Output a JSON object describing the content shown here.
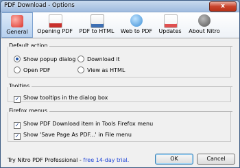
{
  "window": {
    "title": "PDF Download - Options",
    "close_label": "x"
  },
  "tabs": [
    {
      "label": "General",
      "icon": "general-icon",
      "color": "#d9342b"
    },
    {
      "label": "Opening PDF",
      "icon": "opening-pdf-icon",
      "color": "#c9302c"
    },
    {
      "label": "PDF to HTML",
      "icon": "pdf-to-html-icon",
      "color": "#3e6fb3"
    },
    {
      "label": "Web to PDF",
      "icon": "web-to-pdf-icon",
      "color": "#3d8fd6"
    },
    {
      "label": "Updates",
      "icon": "updates-icon",
      "color": "#e05050"
    },
    {
      "label": "About Nitro",
      "icon": "nitro-icon",
      "color": "#6a6a6a"
    }
  ],
  "default_action": {
    "legend": "Default action",
    "options": [
      {
        "label": "Show popup dialog",
        "selected": true
      },
      {
        "label": "Download it",
        "selected": false
      },
      {
        "label": "Open PDF",
        "selected": false
      },
      {
        "label": "View as HTML",
        "selected": false
      }
    ]
  },
  "tooltips": {
    "legend": "Tooltips",
    "option": {
      "label": "Show tooltips in the dialog box",
      "checked": true
    }
  },
  "firefox": {
    "legend": "Firefox menus",
    "options": [
      {
        "label": "Show PDF Download item in Tools Firefox menu",
        "checked": true
      },
      {
        "label": "Show 'Save Page As PDF...' in File menu",
        "checked": true
      }
    ]
  },
  "footer": {
    "text": "Try Nitro PDF Professional - ",
    "link": "free 14-day trial.",
    "ok": "OK",
    "cancel": "Cancel"
  }
}
